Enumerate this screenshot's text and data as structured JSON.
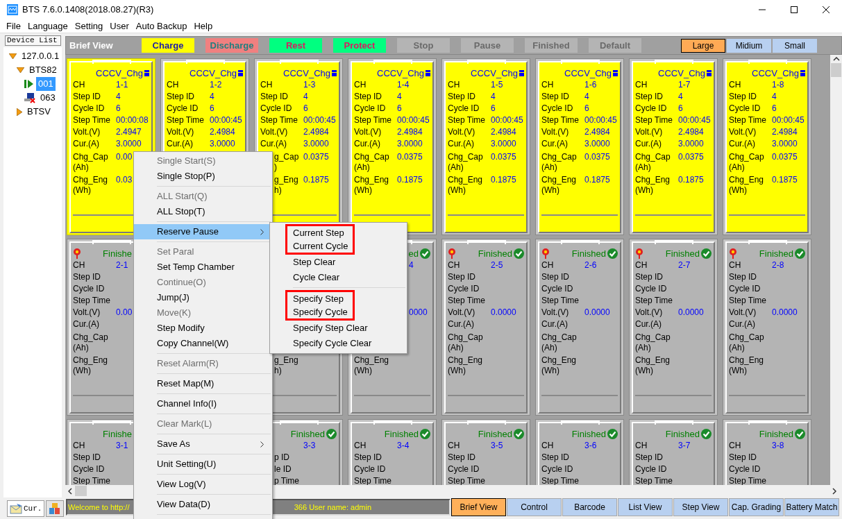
{
  "window": {
    "title": "BTS 7.6.0.1408(2018.08.27)(R3)"
  },
  "menu_bar": [
    "File",
    "Language",
    "Setting",
    "User",
    "Auto Backup",
    "Help"
  ],
  "device_list": {
    "title": "Device List",
    "tree": [
      {
        "label": "127.0.0.1",
        "kind": "host",
        "expanded": true,
        "selected": false,
        "children": [
          {
            "label": "BTS82",
            "kind": "unit",
            "expanded": true,
            "selected": false,
            "children": [
              {
                "label": "001",
                "kind": "running",
                "selected": true
              },
              {
                "label": "063",
                "kind": "offline",
                "selected": false
              }
            ]
          },
          {
            "label": "BTSV",
            "kind": "unit",
            "expanded": false,
            "selected": false
          }
        ]
      }
    ]
  },
  "sidebar_tabs": [
    {
      "label": "Cur.",
      "kind": "current",
      "selected": true
    },
    {
      "kind": "blocks",
      "selected": false
    }
  ],
  "view_title": "Brief View",
  "legend": [
    {
      "label": "Charge",
      "color": "#ffff00"
    },
    {
      "label": "Discharge",
      "color": "#f08080"
    },
    {
      "label": "Rest",
      "color": "#00ff80"
    },
    {
      "label": "Protect",
      "color": "#00ff80"
    },
    {
      "label": "Stop",
      "color": "#b4b4b4"
    },
    {
      "label": "Pause",
      "color": "#b4b4b4"
    },
    {
      "label": "Finished",
      "color": "#b4b4b4"
    },
    {
      "label": "Default",
      "color": "#b4b4b4"
    }
  ],
  "sizes": [
    {
      "label": "Large",
      "selected": true
    },
    {
      "label": "Midium",
      "selected": false
    },
    {
      "label": "Small",
      "selected": false
    }
  ],
  "rows": [
    {
      "cards": [
        {
          "kind": "charge",
          "selected": true,
          "marker": false,
          "status": "CCCV_Chg",
          "icon": true,
          "fields": {
            "ch": {
              "label": "CH",
              "value": "1-1"
            },
            "step_id": {
              "label": "Step ID",
              "value": "4"
            },
            "cycle_id": {
              "label": "Cycle ID",
              "value": "6"
            },
            "step_time": {
              "label": "Step Time",
              "value": "00:00:08"
            },
            "volt": {
              "label": "Volt.(V)",
              "value": "2.4947"
            },
            "cur": {
              "label": "Cur.(A)",
              "value": "3.0000"
            },
            "chg_cap": {
              "label": "Chg_Cap",
              "unit": "(Ah)",
              "value": "0.00"
            },
            "chg_eng": {
              "label": "Chg_Eng",
              "unit": "(Wh)",
              "value": "0.03"
            }
          }
        },
        {
          "kind": "charge",
          "selected": false,
          "marker": false,
          "status": "CCCV_Chg",
          "icon": true,
          "fields": {
            "ch": {
              "label": "CH",
              "value": "1-2"
            },
            "step_id": {
              "label": "Step ID",
              "value": "4"
            },
            "cycle_id": {
              "label": "Cycle ID",
              "value": "6"
            },
            "step_time": {
              "label": "Step Time",
              "value": "00:00:45"
            },
            "volt": {
              "label": "Volt.(V)",
              "value": "2.4984"
            },
            "cur": {
              "label": "Cur.(A)",
              "value": "3.0000"
            }
          }
        },
        {
          "kind": "charge",
          "selected": false,
          "marker": false,
          "status": "CCCV_Chg",
          "icon": true,
          "fields": {
            "ch": {
              "label": "CH",
              "value": "1-3"
            },
            "step_id": {
              "label": "Step ID",
              "value": "4"
            },
            "cycle_id": {
              "label": "Cycle ID",
              "value": "6"
            },
            "step_time": {
              "label": "Step Time",
              "value": "00:00:45"
            },
            "volt": {
              "label": "Volt.(V)",
              "value": "2.4984"
            },
            "cur": {
              "label": "Cur.(A)",
              "value": "3.0000"
            },
            "chg_cap": {
              "label": "g_Cap",
              "unit": ")",
              "value": "0.0375"
            },
            "chg_eng": {
              "label": "g_Eng",
              "unit": "h)",
              "value": "0.1875"
            }
          }
        },
        {
          "kind": "charge",
          "selected": false,
          "marker": false,
          "status": "CCCV_Chg",
          "icon": true,
          "fields": {
            "ch": {
              "label": "CH",
              "value": "1-4"
            },
            "step_id": {
              "label": "Step ID",
              "value": "4"
            },
            "cycle_id": {
              "label": "Cycle ID",
              "value": "6"
            },
            "step_time": {
              "label": "Step Time",
              "value": "00:00:45"
            },
            "volt": {
              "label": "Volt.(V)",
              "value": "2.4984"
            },
            "cur": {
              "label": "Cur.(A)",
              "value": "3.0000"
            },
            "chg_cap": {
              "label": "Chg_Cap",
              "unit": "(Ah)",
              "value": "0.0375"
            },
            "chg_eng": {
              "label": "Chg_Eng",
              "unit": "(Wh)",
              "value": "0.1875"
            }
          }
        },
        {
          "kind": "charge",
          "selected": false,
          "marker": false,
          "status": "CCCV_Chg",
          "icon": true,
          "fields": {
            "ch": {
              "label": "CH",
              "value": "1-5"
            },
            "step_id": {
              "label": "Step ID",
              "value": "4"
            },
            "cycle_id": {
              "label": "Cycle ID",
              "value": "6"
            },
            "step_time": {
              "label": "Step Time",
              "value": "00:00:45"
            },
            "volt": {
              "label": "Volt.(V)",
              "value": "2.4984"
            },
            "cur": {
              "label": "Cur.(A)",
              "value": "3.0000"
            },
            "chg_cap": {
              "label": "Chg_Cap",
              "unit": "(Ah)",
              "value": "0.0375"
            },
            "chg_eng": {
              "label": "Chg_Eng",
              "unit": "(Wh)",
              "value": "0.1875"
            }
          }
        },
        {
          "kind": "charge",
          "selected": false,
          "marker": false,
          "status": "CCCV_Chg",
          "icon": true,
          "fields": {
            "ch": {
              "label": "CH",
              "value": "1-6"
            },
            "step_id": {
              "label": "Step ID",
              "value": "4"
            },
            "cycle_id": {
              "label": "Cycle ID",
              "value": "6"
            },
            "step_time": {
              "label": "Step Time",
              "value": "00:00:45"
            },
            "volt": {
              "label": "Volt.(V)",
              "value": "2.4984"
            },
            "cur": {
              "label": "Cur.(A)",
              "value": "3.0000"
            },
            "chg_cap": {
              "label": "Chg_Cap",
              "unit": "(Ah)",
              "value": "0.0375"
            },
            "chg_eng": {
              "label": "Chg_Eng",
              "unit": "(Wh)",
              "value": "0.1875"
            }
          }
        },
        {
          "kind": "charge",
          "selected": false,
          "marker": false,
          "status": "CCCV_Chg",
          "icon": true,
          "fields": {
            "ch": {
              "label": "CH",
              "value": "1-7"
            },
            "step_id": {
              "label": "Step ID",
              "value": "4"
            },
            "cycle_id": {
              "label": "Cycle ID",
              "value": "6"
            },
            "step_time": {
              "label": "Step Time",
              "value": "00:00:45"
            },
            "volt": {
              "label": "Volt.(V)",
              "value": "2.4984"
            },
            "cur": {
              "label": "Cur.(A)",
              "value": "3.0000"
            },
            "chg_cap": {
              "label": "Chg_Cap",
              "unit": "(Ah)",
              "value": "0.0375"
            },
            "chg_eng": {
              "label": "Chg_Eng",
              "unit": "(Wh)",
              "value": "0.1875"
            }
          }
        },
        {
          "kind": "charge",
          "selected": false,
          "marker": false,
          "status": "CCCV_Chg",
          "icon": true,
          "fields": {
            "ch": {
              "label": "CH",
              "value": "1-8"
            },
            "step_id": {
              "label": "Step ID",
              "value": "4"
            },
            "cycle_id": {
              "label": "Cycle ID",
              "value": "6"
            },
            "step_time": {
              "label": "Step Time",
              "value": "00:00:45"
            },
            "volt": {
              "label": "Volt.(V)",
              "value": "2.4984"
            },
            "cur": {
              "label": "Cur.(A)",
              "value": "3.0000"
            },
            "chg_cap": {
              "label": "Chg_Cap",
              "unit": "(Ah)",
              "value": "0.0375"
            },
            "chg_eng": {
              "label": "Chg_Eng",
              "unit": "(Wh)",
              "value": "0.1875"
            }
          }
        }
      ]
    },
    {
      "cards": [
        {
          "kind": "finished",
          "selected": false,
          "marker": true,
          "status": "Finishe",
          "icon": false,
          "fields": {
            "ch": {
              "label": "CH",
              "value": "2-1"
            },
            "step_id": {
              "label": "Step ID"
            },
            "cycle_id": {
              "label": "Cycle ID"
            },
            "step_time": {
              "label": "Step Time"
            },
            "volt": {
              "label": "Volt.(V)",
              "value": "0.00"
            },
            "cur": {
              "label": "Cur.(A)"
            },
            "chg_cap": {
              "label": "Chg_Cap",
              "unit": "(Ah)"
            },
            "chg_eng": {
              "label": "Chg_Eng",
              "unit": "(Wh)"
            }
          }
        },
        {
          "kind": "covered"
        },
        {
          "kind": "finished",
          "selected": false,
          "marker": false,
          "icon": false,
          "fields": {
            "chg_eng": {
              "label": "g_Eng",
              "unit": "h)"
            }
          }
        },
        {
          "kind": "finished",
          "selected": false,
          "marker": false,
          "status": "ed",
          "icon": true,
          "fields": {
            "ch": {
              "value": "4"
            },
            "volt": {
              "value": "0000"
            },
            "chg_eng": {
              "label": "Chg_Eng",
              "unit": "(Wh)"
            }
          }
        },
        {
          "kind": "finished",
          "selected": false,
          "marker": true,
          "status": "Finished",
          "icon": true,
          "fields": {
            "ch": {
              "label": "CH",
              "value": "2-5"
            },
            "step_id": {
              "label": "Step ID"
            },
            "cycle_id": {
              "label": "Cycle ID"
            },
            "step_time": {
              "label": "Step Time"
            },
            "volt": {
              "label": "Volt.(V)",
              "value": "0.0000"
            },
            "cur": {
              "label": "Cur.(A)"
            },
            "chg_cap": {
              "label": "Chg_Cap",
              "unit": "(Ah)"
            },
            "chg_eng": {
              "label": "Chg_Eng",
              "unit": "(Wh)"
            }
          }
        },
        {
          "kind": "finished",
          "selected": false,
          "marker": true,
          "status": "Finished",
          "icon": true,
          "fields": {
            "ch": {
              "label": "CH",
              "value": "2-6"
            },
            "step_id": {
              "label": "Step ID"
            },
            "cycle_id": {
              "label": "Cycle ID"
            },
            "step_time": {
              "label": "Step Time"
            },
            "volt": {
              "label": "Volt.(V)",
              "value": "0.0000"
            },
            "cur": {
              "label": "Cur.(A)"
            },
            "chg_cap": {
              "label": "Chg_Cap",
              "unit": "(Ah)"
            },
            "chg_eng": {
              "label": "Chg_Eng",
              "unit": "(Wh)"
            }
          }
        },
        {
          "kind": "finished",
          "selected": false,
          "marker": true,
          "status": "Finished",
          "icon": true,
          "fields": {
            "ch": {
              "label": "CH",
              "value": "2-7"
            },
            "step_id": {
              "label": "Step ID"
            },
            "cycle_id": {
              "label": "Cycle ID"
            },
            "step_time": {
              "label": "Step Time"
            },
            "volt": {
              "label": "Volt.(V)",
              "value": "0.0000"
            },
            "cur": {
              "label": "Cur.(A)"
            },
            "chg_cap": {
              "label": "Chg_Cap",
              "unit": "(Ah)"
            },
            "chg_eng": {
              "label": "Chg_Eng",
              "unit": "(Wh)"
            }
          }
        },
        {
          "kind": "finished",
          "selected": false,
          "marker": true,
          "status": "Finished",
          "icon": true,
          "fields": {
            "ch": {
              "label": "CH",
              "value": "2-8"
            },
            "step_id": {
              "label": "Step ID"
            },
            "cycle_id": {
              "label": "Cycle ID"
            },
            "step_time": {
              "label": "Step Time"
            },
            "volt": {
              "label": "Volt.(V)",
              "value": "0.0000"
            },
            "cur": {
              "label": "Cur.(A)"
            },
            "chg_cap": {
              "label": "Chg_Cap",
              "unit": "(Ah)"
            },
            "chg_eng": {
              "label": "Chg_Eng",
              "unit": "(Wh)"
            }
          }
        }
      ]
    },
    {
      "cards": [
        {
          "kind": "finished",
          "selected": false,
          "marker": false,
          "status": "Finishe",
          "icon": false,
          "fields": {
            "ch": {
              "label": "CH",
              "value": "3-1"
            },
            "step_id": {
              "label": "Step ID"
            },
            "cycle_id": {
              "label": "Cycle ID"
            },
            "step_time": {
              "label": "Step Time"
            }
          }
        },
        {
          "kind": "covered"
        },
        {
          "kind": "finished",
          "selected": false,
          "marker": false,
          "status": "Finished",
          "icon": true,
          "fields": {
            "ch": {
              "value": "3-3"
            },
            "step_id": {
              "label": "p ID"
            },
            "cycle_id": {
              "label": "le ID"
            },
            "step_time": {
              "label": "p Time"
            }
          }
        },
        {
          "kind": "finished",
          "selected": false,
          "marker": false,
          "status": "Finished",
          "icon": true,
          "fields": {
            "ch": {
              "label": "CH",
              "value": "3-4"
            },
            "step_id": {
              "label": "Step ID"
            },
            "cycle_id": {
              "label": "Cycle ID"
            },
            "step_time": {
              "label": "Step Time"
            }
          }
        },
        {
          "kind": "finished",
          "selected": false,
          "marker": false,
          "status": "Finished",
          "icon": true,
          "fields": {
            "ch": {
              "label": "CH",
              "value": "3-5"
            },
            "step_id": {
              "label": "Step ID"
            },
            "cycle_id": {
              "label": "Cycle ID"
            },
            "step_time": {
              "label": "Step Time"
            }
          }
        },
        {
          "kind": "finished",
          "selected": false,
          "marker": false,
          "status": "Finished",
          "icon": true,
          "fields": {
            "ch": {
              "label": "CH",
              "value": "3-6"
            },
            "step_id": {
              "label": "Step ID"
            },
            "cycle_id": {
              "label": "Cycle ID"
            },
            "step_time": {
              "label": "Step Time"
            }
          }
        },
        {
          "kind": "finished",
          "selected": false,
          "marker": false,
          "status": "Finished",
          "icon": true,
          "fields": {
            "ch": {
              "label": "CH",
              "value": "3-7"
            },
            "step_id": {
              "label": "Step ID"
            },
            "cycle_id": {
              "label": "Cycle ID"
            },
            "step_time": {
              "label": "Step Time"
            }
          }
        },
        {
          "kind": "finished",
          "selected": false,
          "marker": false,
          "status": "Finished",
          "icon": true,
          "fields": {
            "ch": {
              "label": "CH",
              "value": "3-8"
            },
            "step_id": {
              "label": "Step ID"
            },
            "cycle_id": {
              "label": "Cycle ID"
            },
            "step_time": {
              "label": "Step Time"
            }
          }
        }
      ]
    }
  ],
  "status_bar": {
    "messages": [
      "Welcome to http://",
      "366  User name: admin"
    ]
  },
  "bottom_tabs": [
    {
      "label": "Brief View",
      "selected": true
    },
    {
      "label": "Control",
      "selected": false
    },
    {
      "label": "Barcode",
      "selected": false
    },
    {
      "label": "List View",
      "selected": false
    },
    {
      "label": "Step View",
      "selected": false
    },
    {
      "label": "Cap. Grading",
      "selected": false
    },
    {
      "label": "Battery Match",
      "selected": false
    }
  ],
  "context_menu": {
    "items": [
      {
        "kind": "item",
        "label": "Single Start(S)",
        "disabled": true,
        "highlighted": false,
        "submenu": false
      },
      {
        "kind": "item",
        "label": "Single Stop(P)",
        "disabled": false,
        "highlighted": false,
        "submenu": false
      },
      {
        "kind": "separator"
      },
      {
        "kind": "item",
        "label": "ALL Start(Q)",
        "disabled": true,
        "highlighted": false,
        "submenu": false
      },
      {
        "kind": "item",
        "label": "ALL Stop(T)",
        "disabled": false,
        "highlighted": false,
        "submenu": false
      },
      {
        "kind": "separator"
      },
      {
        "kind": "item",
        "label": "Reserve Pause",
        "disabled": false,
        "highlighted": true,
        "submenu": true
      },
      {
        "kind": "separator"
      },
      {
        "kind": "item",
        "label": "Set Paral",
        "disabled": true,
        "highlighted": false,
        "submenu": false
      },
      {
        "kind": "item",
        "label": "Set Temp Chamber",
        "disabled": false,
        "highlighted": false,
        "submenu": false
      },
      {
        "kind": "item",
        "label": "Continue(O)",
        "disabled": true,
        "highlighted": false,
        "submenu": false
      },
      {
        "kind": "item",
        "label": "Jump(J)",
        "disabled": false,
        "highlighted": false,
        "submenu": false
      },
      {
        "kind": "item",
        "label": "Move(K)",
        "disabled": true,
        "highlighted": false,
        "submenu": false
      },
      {
        "kind": "item",
        "label": "Step Modify",
        "disabled": false,
        "highlighted": false,
        "submenu": false
      },
      {
        "kind": "item",
        "label": "Copy Channel(W)",
        "disabled": false,
        "highlighted": false,
        "submenu": false
      },
      {
        "kind": "separator"
      },
      {
        "kind": "item",
        "label": "Reset Alarm(R)",
        "disabled": true,
        "highlighted": false,
        "submenu": false
      },
      {
        "kind": "separator"
      },
      {
        "kind": "item",
        "label": "Reset Map(M)",
        "disabled": false,
        "highlighted": false,
        "submenu": false
      },
      {
        "kind": "separator"
      },
      {
        "kind": "item",
        "label": "Channel Info(I)",
        "disabled": false,
        "highlighted": false,
        "submenu": false
      },
      {
        "kind": "separator"
      },
      {
        "kind": "item",
        "label": "Clear Mark(L)",
        "disabled": true,
        "highlighted": false,
        "submenu": false
      },
      {
        "kind": "separator"
      },
      {
        "kind": "item",
        "label": "Save As",
        "disabled": false,
        "highlighted": false,
        "submenu": true
      },
      {
        "kind": "separator"
      },
      {
        "kind": "item",
        "label": "Unit Setting(U)",
        "disabled": false,
        "highlighted": false,
        "submenu": false
      },
      {
        "kind": "separator"
      },
      {
        "kind": "item",
        "label": "View Log(V)",
        "disabled": false,
        "highlighted": false,
        "submenu": false
      },
      {
        "kind": "separator"
      },
      {
        "kind": "item",
        "label": "View Data(D)",
        "disabled": false,
        "highlighted": false,
        "submenu": false
      },
      {
        "kind": "separator"
      }
    ]
  },
  "submenu": {
    "items": [
      {
        "kind": "group",
        "outlined": true,
        "items": [
          "Current Step",
          "Current Cycle"
        ]
      },
      {
        "kind": "group",
        "outlined": false,
        "items": [
          "Step Clear",
          "Cycle Clear"
        ]
      },
      {
        "kind": "separator"
      },
      {
        "kind": "group",
        "outlined": true,
        "items": [
          "Specify Step",
          "Specify Cycle"
        ]
      },
      {
        "kind": "group",
        "outlined": false,
        "items": [
          "Specify Step Clear",
          "Specify Cycle Clear"
        ]
      }
    ]
  }
}
